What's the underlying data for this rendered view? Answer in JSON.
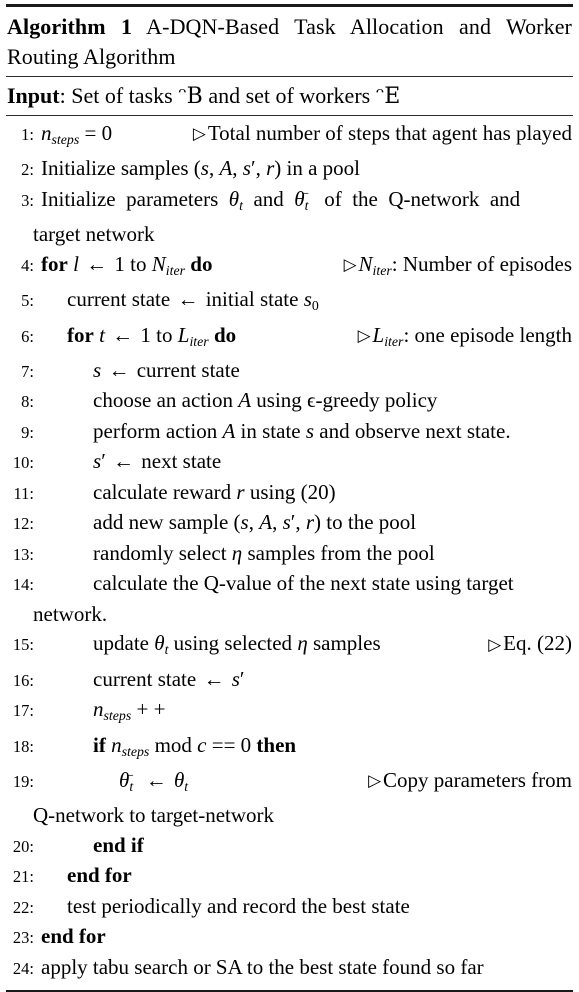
{
  "algorithm": {
    "label": "Algorithm 1",
    "title": "A-DQN-Based Task Allocation and Worker Routing Algorithm",
    "input_label": "Input",
    "input_text": ": Set of tasks ᵔB and set of workers ᵔE",
    "input_tasks_symbol": "ᵔB",
    "input_workers_symbol": "ᵔE",
    "lines": [
      {
        "no": "1:",
        "indent": 0,
        "text": "n_steps = 0",
        "comment": "▷ Total number of steps that agent has played"
      },
      {
        "no": "2:",
        "indent": 0,
        "text": "Initialize samples (s, A, s′, r) in a pool",
        "comment": ""
      },
      {
        "no": "3:",
        "indent": 0,
        "text": "Initialize parameters θ_t and θ⁻_t of the Q-network and target network",
        "comment": "",
        "continuation": "target network"
      },
      {
        "no": "4:",
        "indent": 0,
        "text": "for l ← 1 to N_iter do",
        "comment": "▷ N_iter: Number of episodes"
      },
      {
        "no": "5:",
        "indent": 1,
        "text": "current state ← initial state s₀",
        "comment": ""
      },
      {
        "no": "6:",
        "indent": 1,
        "text": "for t ← 1 to L_iter do",
        "comment": "▷ L_iter: one episode length"
      },
      {
        "no": "7:",
        "indent": 2,
        "text": "s ← current state",
        "comment": ""
      },
      {
        "no": "8:",
        "indent": 2,
        "text": "choose an action A using ϵ-greedy policy",
        "comment": ""
      },
      {
        "no": "9:",
        "indent": 2,
        "text": "perform action A in state s and observe next state.",
        "comment": ""
      },
      {
        "no": "10:",
        "indent": 2,
        "text": "s′ ← next state",
        "comment": ""
      },
      {
        "no": "11:",
        "indent": 2,
        "text": "calculate reward r using (20)",
        "comment": ""
      },
      {
        "no": "12:",
        "indent": 2,
        "text": "add new sample (s, A, s′, r) to the pool",
        "comment": ""
      },
      {
        "no": "13:",
        "indent": 2,
        "text": "randomly select η samples from the pool",
        "comment": ""
      },
      {
        "no": "14:",
        "indent": 2,
        "text": "calculate the Q-value of the next state using target network.",
        "comment": "",
        "continuation": "network."
      },
      {
        "no": "15:",
        "indent": 2,
        "text": "update θ_t using selected η samples",
        "comment": "▷ Eq. (22)"
      },
      {
        "no": "16:",
        "indent": 2,
        "text": "current state ← s′",
        "comment": ""
      },
      {
        "no": "17:",
        "indent": 2,
        "text": "n_steps + +",
        "comment": ""
      },
      {
        "no": "18:",
        "indent": 2,
        "text": "if n_steps mod c == 0 then",
        "comment": ""
      },
      {
        "no": "19:",
        "indent": 3,
        "text": "θ⁻_t ← θ_t",
        "comment": "▷ Copy parameters from",
        "continuation": "Q-network to target-network"
      },
      {
        "no": "20:",
        "indent": 2,
        "text": "end if",
        "comment": ""
      },
      {
        "no": "21:",
        "indent": 1,
        "text": "end for",
        "comment": ""
      },
      {
        "no": "22:",
        "indent": 1,
        "text": "test periodically and record the best state",
        "comment": ""
      },
      {
        "no": "23:",
        "indent": 0,
        "text": "end for",
        "comment": ""
      },
      {
        "no": "24:",
        "indent": 0,
        "text": "apply tabu search or SA to the best state found so far",
        "comment": ""
      }
    ]
  }
}
